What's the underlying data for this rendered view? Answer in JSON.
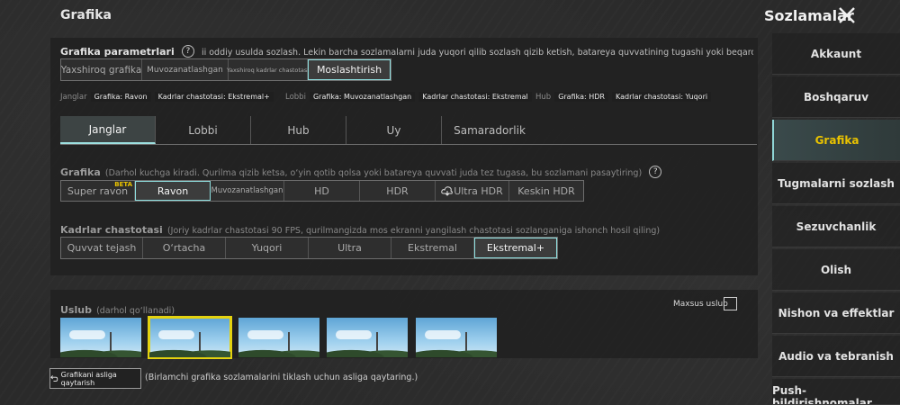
{
  "header": {
    "title": "Grafika",
    "settings_title": "Sozlamalar"
  },
  "graphics_params": {
    "label": "Grafika parametrlari",
    "help": "?",
    "desc": "ii oddiy usulda sozlash. Lekin barcha sozlamalarni juda yuqori qilib sozlash qizib ketish, batareya quvvatining tugashi yoki beqaror geympley kabi unumdorlik muammola",
    "presets": [
      "Yaxshiroq grafika",
      "Muvozanatlashgan",
      "Yaxshiroq kadrlar chastotasi",
      "Moslashtirish"
    ],
    "selected": "Moslashtirish",
    "summary": {
      "battle": {
        "label": "Janglar",
        "tags": [
          "Grafika: Ravon",
          "Kadrlar chastotasi: Ekstremal+"
        ]
      },
      "lobby": {
        "label": "Lobbi",
        "tags": [
          "Grafika: Muvozanatlashgan",
          "Kadrlar chastotasi: Ekstremal"
        ]
      },
      "hub": {
        "label": "Hub",
        "tags": [
          "Grafika: HDR",
          "Kadrlar chastotasi: Yuqori"
        ]
      }
    }
  },
  "tabs": [
    "Janglar",
    "Lobbi",
    "Hub",
    "Uy",
    "Samaradorlik"
  ],
  "graphics": {
    "label": "Grafika",
    "desc": "(Darhol kuchga kiradi. Qurilma qizib ketsa, o‘yin qotib qolsa yoki batareya quvvati juda tez tugasa, bu sozlamani pasaytiring)",
    "help": "?",
    "options": [
      "Super ravon",
      "Ravon",
      "Muvozanatlashgan",
      "HD",
      "HDR",
      "Ultra HDR",
      "Keskin HDR"
    ],
    "beta": "BETA",
    "selected": "Ravon"
  },
  "framerate": {
    "label": "Kadrlar chastotasi",
    "desc": "(Joriy kadrlar chastotasi 90 FPS, qurilmangizda mos ekranni yangilash chastotasi sozlanganiga ishonch hosil qiling)",
    "options": [
      "Quvvat tejash",
      "O‘rtacha",
      "Yuqori",
      "Ultra",
      "Ekstremal",
      "Ekstremal+"
    ],
    "selected": "Ekstremal+"
  },
  "style": {
    "label": "Uslub",
    "note": "(darhol qo‘llanadi)",
    "custom_label": "Maxsus uslub"
  },
  "reset": {
    "button": "Grafikani asliga qaytarish",
    "note": "(Birlamchi grafika sozlamalarini tiklash uchun asliga qaytaring.)"
  },
  "sidebar": [
    "Akkaunt",
    "Boshqaruv",
    "Grafika",
    "Tugmalarni sozlash",
    "Sezuvchanlik",
    "Olish",
    "Nishon va effektlar",
    "Audio va tebranish",
    "Push-bildirishnomalar"
  ],
  "sidebar_selected": "Grafika",
  "colors": {
    "accent": "#8fe0e0",
    "highlight": "#e9c200"
  }
}
